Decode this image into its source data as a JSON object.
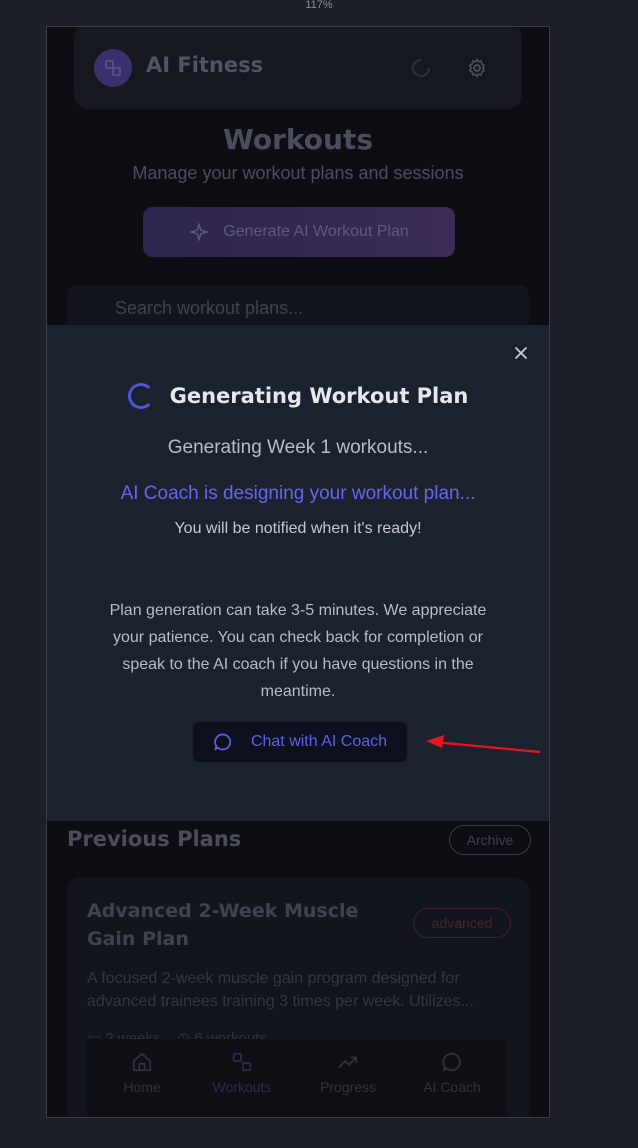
{
  "browser": {
    "zoom": "117%"
  },
  "app": {
    "name": "AI Fitness",
    "page_title": "Workouts",
    "page_subtitle": "Manage your workout plans and sessions",
    "generate_button": "Generate AI Workout Plan",
    "search_placeholder": "Search workout plans...",
    "previous_plans_title": "Previous Plans",
    "archive_button": "Archive",
    "plan": {
      "name": "Advanced 2-Week Muscle Gain Plan",
      "badge": "advanced",
      "description_line1": "A focused 2-week muscle gain program designed for",
      "description_line2": "advanced trainees training 3 times per week. Utilizes...",
      "duration": "2 weeks",
      "workouts": "6 workouts"
    },
    "nav": [
      {
        "label": "Home",
        "icon": "home-icon"
      },
      {
        "label": "Workouts",
        "icon": "dumbbell-icon"
      },
      {
        "label": "Progress",
        "icon": "trending-up-icon"
      },
      {
        "label": "AI Coach",
        "icon": "chat-bubble-icon"
      }
    ]
  },
  "modal": {
    "title": "Generating Workout Plan",
    "status": "Generating Week 1 workouts...",
    "designing": "AI Coach is designing your workout plan...",
    "notify": "You will be notified when it's ready!",
    "info": "Plan generation can take 3-5 minutes. We appreciate your patience. You can check back for completion or speak to the AI coach if you have questions in the meantime.",
    "chat_button": "Chat with AI Coach"
  },
  "colors": {
    "accent": "#5c61e6",
    "designing_text": "#6b63f0",
    "annotation_arrow": "#e8141e"
  }
}
